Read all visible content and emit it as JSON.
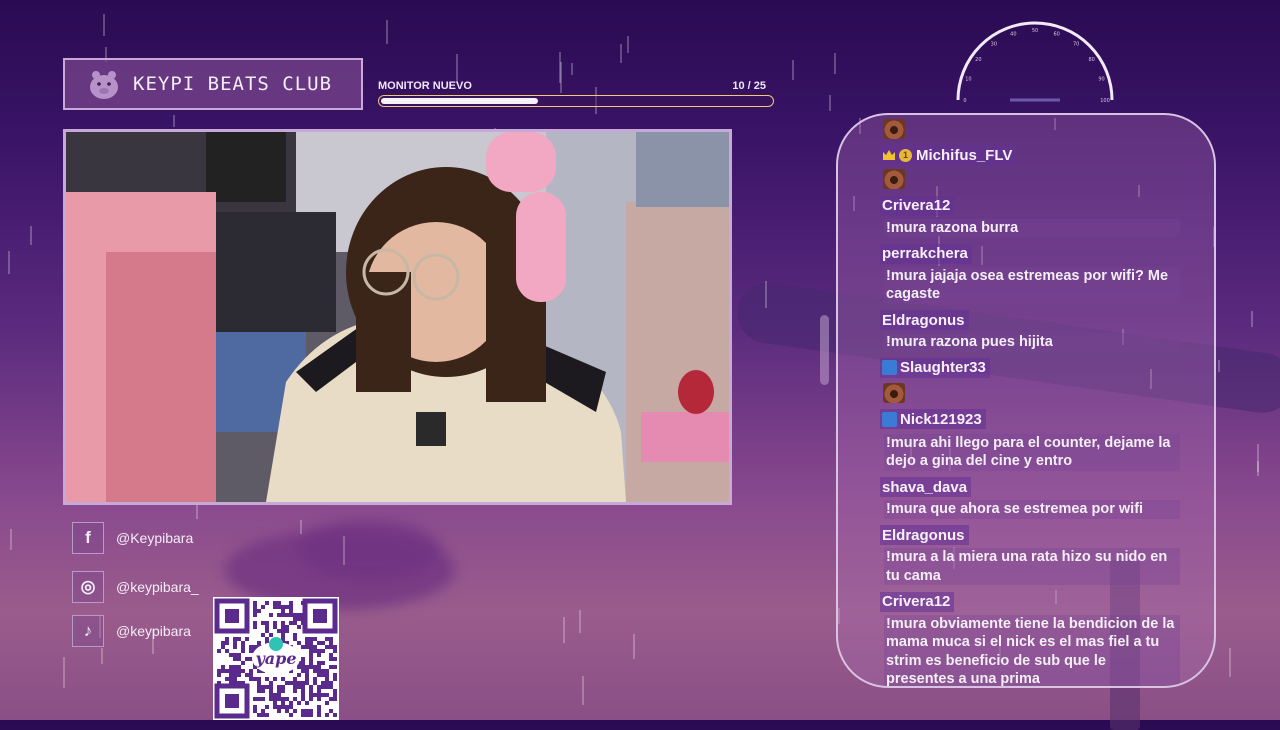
{
  "brand": {
    "title": "KEYPI BEATS CLUB",
    "logo_icon": "capybara-icon"
  },
  "goal": {
    "label": "MONITOR NUEVO",
    "count": "10  / 25",
    "current": 10,
    "target": 25
  },
  "gauge": {
    "ticks": [
      "0",
      "10",
      "20",
      "30",
      "40",
      "50",
      "60",
      "70",
      "80",
      "90",
      "100"
    ]
  },
  "socials": [
    {
      "icon": "facebook-icon",
      "glyph": "f",
      "handle": "@Keypibara"
    },
    {
      "icon": "instagram-icon",
      "glyph": "◎",
      "handle": "@keypibara_"
    },
    {
      "icon": "tiktok-icon",
      "glyph": "♪",
      "handle": "@keypibara"
    }
  ],
  "qr": {
    "brand": "yape"
  },
  "chat": {
    "messages": [
      {
        "user": "",
        "text": "",
        "emote": true
      },
      {
        "user": "Michifus_FLV",
        "text": "",
        "emote": true,
        "badges": [
          "crown",
          "coin"
        ]
      },
      {
        "user": "Crivera12",
        "text": "!mura razona burra"
      },
      {
        "user": "perrakchera",
        "text": "!mura jajaja osea estremeas por wifi? Me cagaste"
      },
      {
        "user": "Eldragonus",
        "text": "!mura razona pues hijita"
      },
      {
        "user": "Slaughter33",
        "text": "",
        "emote": true,
        "badges": [
          "arrow"
        ]
      },
      {
        "user": "Nick121923",
        "text": "!mura ahi llego para el counter, dejame la dejo a gina del cine y entro",
        "badges": [
          "arrow"
        ]
      },
      {
        "user": "shava_dava",
        "text": "!mura que ahora se estremea por wifi"
      },
      {
        "user": "Eldragonus",
        "text": "!mura a la miera una rata hizo su nido en tu cama"
      },
      {
        "user": "Crivera12",
        "text": "!mura obviamente tiene la bendicion de la mama muca si el nick es el mas fiel a tu strim es beneficio de sub que le presentes a una prima"
      }
    ]
  },
  "colors": {
    "accent": "#f2c87a",
    "panel_border": "#c9a9d8",
    "chat_name_bg": "#643296"
  }
}
